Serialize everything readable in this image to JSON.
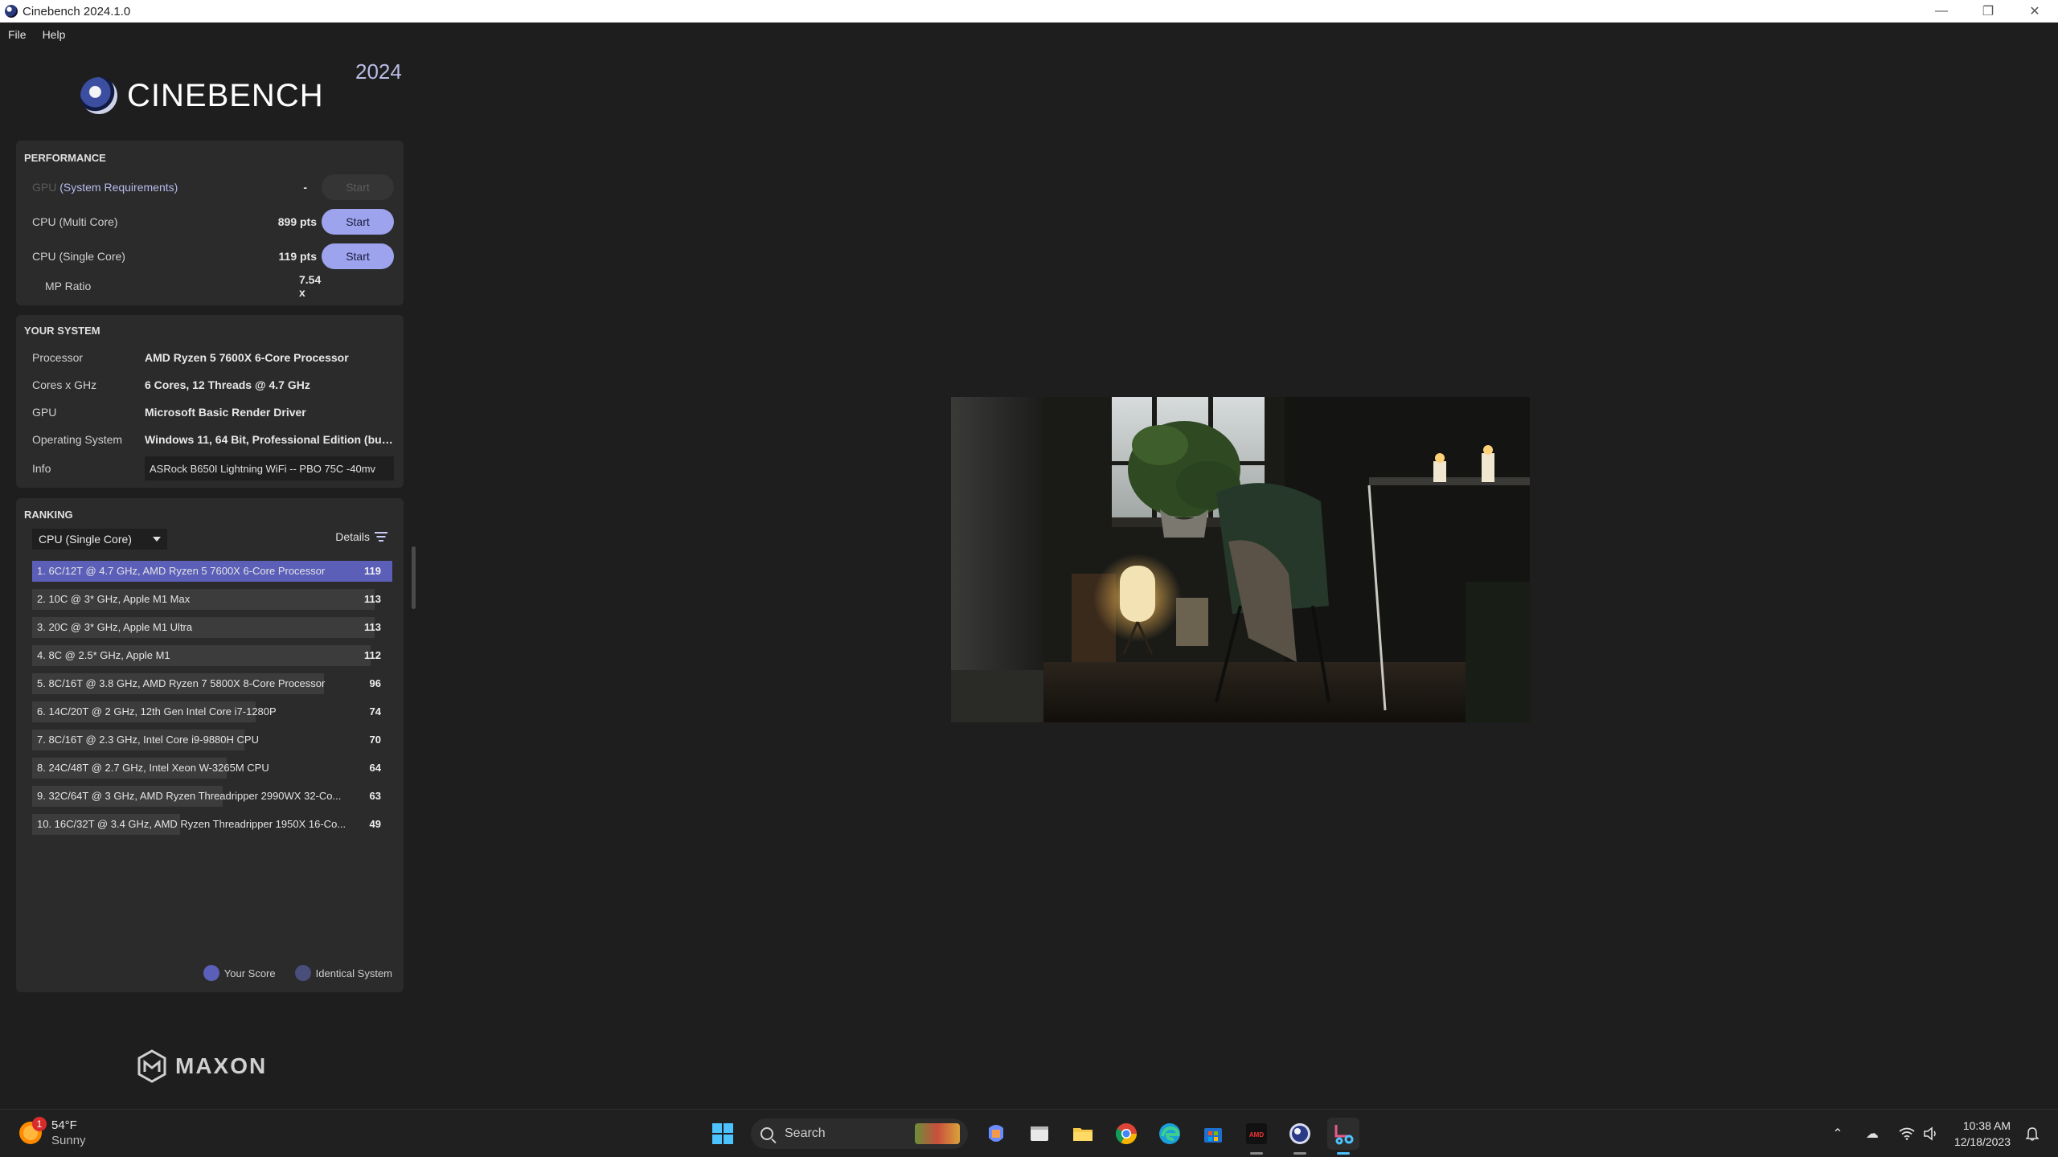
{
  "window": {
    "title": "Cinebench 2024.1.0",
    "controls": [
      "minimize",
      "restore",
      "close"
    ]
  },
  "menu": [
    "File",
    "Help"
  ],
  "brand": {
    "name": "CINEBENCH",
    "year": "2024",
    "vendor": "MAXON"
  },
  "performance": {
    "title": "PERFORMANCE",
    "gpu": {
      "label_dim": "GPU",
      "label_link": "(System Requirements)",
      "score": "-",
      "button": "Start"
    },
    "cpu_multi": {
      "label": "CPU (Multi Core)",
      "score": "899 pts",
      "button": "Start"
    },
    "cpu_single": {
      "label": "CPU (Single Core)",
      "score": "119 pts",
      "button": "Start"
    },
    "mp_ratio": {
      "label": "MP Ratio",
      "value": "7.54 x"
    }
  },
  "system": {
    "title": "YOUR SYSTEM",
    "rows": [
      {
        "key": "Processor",
        "value": "AMD Ryzen 5 7600X 6-Core Processor"
      },
      {
        "key": "Cores x GHz",
        "value": "6 Cores, 12 Threads @ 4.7 GHz"
      },
      {
        "key": "GPU",
        "value": "Microsoft Basic Render Driver"
      },
      {
        "key": "Operating System",
        "value": "Windows 11, 64 Bit, Professional Edition (buil..."
      }
    ],
    "info": {
      "key": "Info",
      "value": "ASRock B650I Lightning WiFi -- PBO 75C -40mv"
    }
  },
  "ranking": {
    "title": "RANKING",
    "dropdown": "CPU (Single Core)",
    "details": "Details",
    "items": [
      {
        "name": "1. 6C/12T @ 4.7 GHz, AMD Ryzen 5 7600X 6-Core Processor",
        "score": "119",
        "fill": 1.0,
        "mine": true
      },
      {
        "name": "2. 10C @ 3* GHz, Apple M1 Max",
        "score": "113",
        "fill": 0.95
      },
      {
        "name": "3. 20C @ 3* GHz, Apple M1 Ultra",
        "score": "113",
        "fill": 0.95
      },
      {
        "name": "4. 8C @ 2.5* GHz, Apple M1",
        "score": "112",
        "fill": 0.94
      },
      {
        "name": "5. 8C/16T @ 3.8 GHz, AMD Ryzen 7 5800X 8-Core Processor",
        "score": "96",
        "fill": 0.81
      },
      {
        "name": "6. 14C/20T @ 2 GHz, 12th Gen Intel Core i7-1280P",
        "score": "74",
        "fill": 0.62
      },
      {
        "name": "7. 8C/16T @ 2.3 GHz, Intel Core i9-9880H CPU",
        "score": "70",
        "fill": 0.59
      },
      {
        "name": "8. 24C/48T @ 2.7 GHz, Intel Xeon W-3265M CPU",
        "score": "64",
        "fill": 0.54
      },
      {
        "name": "9. 32C/64T @ 3 GHz, AMD Ryzen Threadripper 2990WX 32-Co...",
        "score": "63",
        "fill": 0.53
      },
      {
        "name": "10. 16C/32T @ 3.4 GHz, AMD Ryzen Threadripper 1950X 16-Co...",
        "score": "49",
        "fill": 0.41
      }
    ],
    "legend": [
      {
        "label": "Your Score",
        "color": "#5b5fb8"
      },
      {
        "label": "Identical System",
        "color": "#4a4e7a"
      }
    ]
  },
  "taskbar": {
    "weather": {
      "temp": "54°F",
      "condition": "Sunny",
      "badge": "1"
    },
    "search_placeholder": "Search",
    "apps": [
      "windows-start-icon",
      "copilot-icon",
      "terminal-icon",
      "file-explorer-icon",
      "chrome-icon",
      "edge-icon",
      "microsoft-store-icon",
      "amd-software-icon",
      "cinebench-icon",
      "snipping-tool-icon"
    ],
    "time": "10:38 AM",
    "date": "12/18/2023"
  },
  "colors": {
    "accent": "#9ea3ee",
    "your_score": "#5b5fb8",
    "background": "#1e1e1e",
    "panel": "#2b2b2b"
  }
}
